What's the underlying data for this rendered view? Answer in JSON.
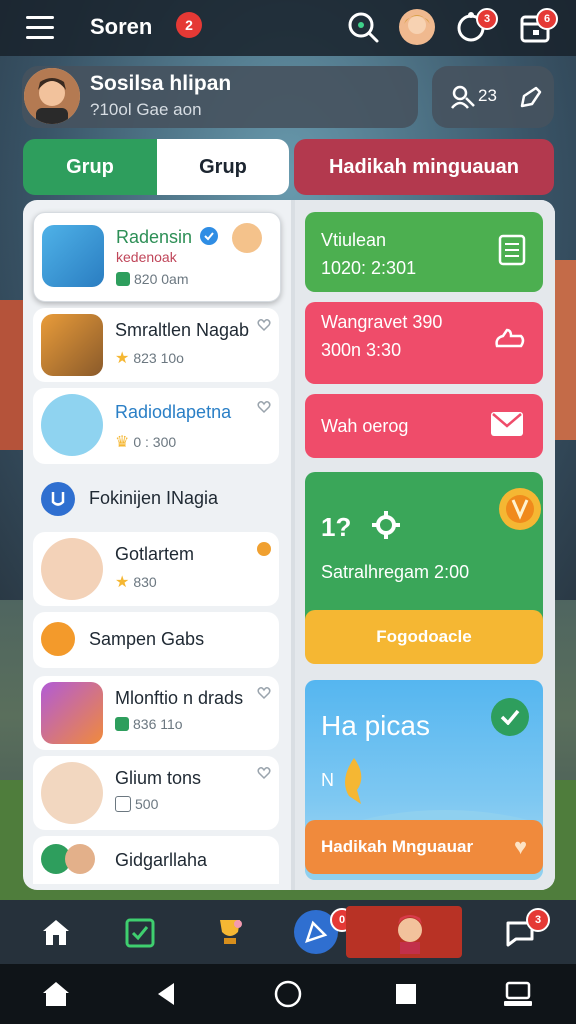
{
  "header": {
    "title": "Soren",
    "title_badge": "2",
    "notif_badge": "3",
    "calendar_badge": "6"
  },
  "profile": {
    "name": "Sosilsa hlipan",
    "subtitle": "?10ol Gae aon",
    "action_value": "23"
  },
  "tabs": [
    {
      "label": "Grup"
    },
    {
      "label": "Grup"
    },
    {
      "label": "Hadikah minguauan"
    }
  ],
  "left_list": {
    "items": [
      {
        "title": "Radensin",
        "subtitle": "kedenoak",
        "meta": "820 0am"
      },
      {
        "title": "Smraltlen Nagab",
        "meta": "823 10o"
      },
      {
        "title": "Radiodlapetna",
        "meta": "0 : 300"
      },
      {
        "title": "Fokinijen INagia"
      },
      {
        "title": "Gotlartem",
        "meta": "830"
      },
      {
        "title": "Sampen Gabs"
      },
      {
        "title": "Mlonftio n drads",
        "meta": "836 11o"
      },
      {
        "title": "Glium tons",
        "meta": "500"
      },
      {
        "title": "Gidgarllaha"
      }
    ]
  },
  "right_cards": [
    {
      "line1": "Vtiulean",
      "line2": "1020: 2:301",
      "color": "#4caf50"
    },
    {
      "line1": "Wangravet 390",
      "line2": "300n 3:30",
      "color": "#ef4c6a"
    },
    {
      "line1": "Wah oerog",
      "color": "#ef4c6a"
    },
    {
      "line1": "1?",
      "line2": "Satralhregam 2:00",
      "color": "#3aa659"
    },
    {
      "button": "Fogodoacle",
      "color": "#f5b733"
    },
    {
      "title": "Ha picas",
      "small": "N"
    },
    {
      "button": "Hadikah Mnguauar",
      "color": "#f08a3c"
    }
  ],
  "bottom_nav": {
    "badge_1": "0",
    "badge_2": "3"
  },
  "colors": {
    "green": "#2e9e5d",
    "red_tab": "#b3394e",
    "badge": "#e53935"
  }
}
